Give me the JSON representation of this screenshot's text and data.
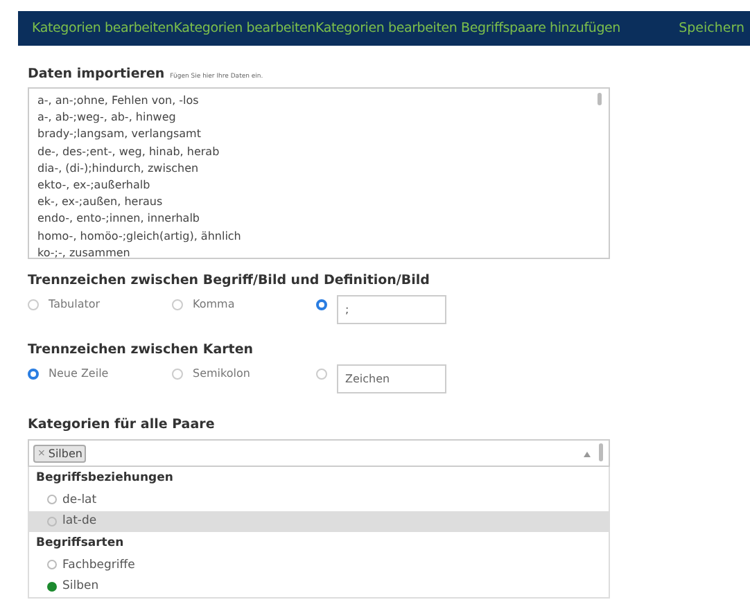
{
  "header": {
    "title": "Kategorien bearbeitenKategorien bearbeitenKategorien bearbeiten Begriffspaare hinzufügen",
    "save": "Speichern"
  },
  "import": {
    "heading": "Daten importieren",
    "hint": "Fügen Sie hier Ihre Daten ein.",
    "lines": [
      "a-, an-;ohne, Fehlen von, -los",
      "a-, ab-;weg-, ab-, hinweg",
      "brady-;langsam, verlangsamt",
      "de-, des-;ent-, weg, hinab, herab",
      "dia-, (di-);hindurch, zwischen",
      "ekto-, ex-;außerhalb",
      "ek-, ex-;außen, heraus",
      "endo-, ento-;innen, innerhalb",
      "homo-, homöo-;gleich(artig), ähnlich",
      "ko-;-, zusammen"
    ]
  },
  "separators": [
    {
      "heading": "Trennzeichen zwischen Begriff/Bild und Definition/Bild",
      "options": [
        {
          "label": "Tabulator",
          "selected": false
        },
        {
          "label": "Komma",
          "selected": false
        }
      ],
      "custom": {
        "selected": true,
        "value": ";"
      }
    },
    {
      "heading": "Trennzeichen zwischen Karten",
      "options": [
        {
          "label": "Neue Zeile",
          "selected": true
        },
        {
          "label": "Semikolon",
          "selected": false
        }
      ],
      "custom": {
        "selected": false,
        "placeholder": "Zeichen"
      }
    }
  ],
  "categories": {
    "heading": "Kategorien für alle Paare",
    "tags": [
      {
        "remove": "×",
        "label": "Silben"
      }
    ],
    "groups": [
      {
        "title": "Begriffsbeziehungen",
        "options": [
          {
            "label": "de-lat",
            "checked": false,
            "highlighted": false
          },
          {
            "label": "lat-de",
            "checked": false,
            "highlighted": true
          }
        ]
      },
      {
        "title": "Begriffsarten",
        "options": [
          {
            "label": "Fachbegriffe",
            "checked": false,
            "highlighted": false
          },
          {
            "label": "Silben",
            "checked": true,
            "highlighted": false
          }
        ]
      }
    ]
  }
}
